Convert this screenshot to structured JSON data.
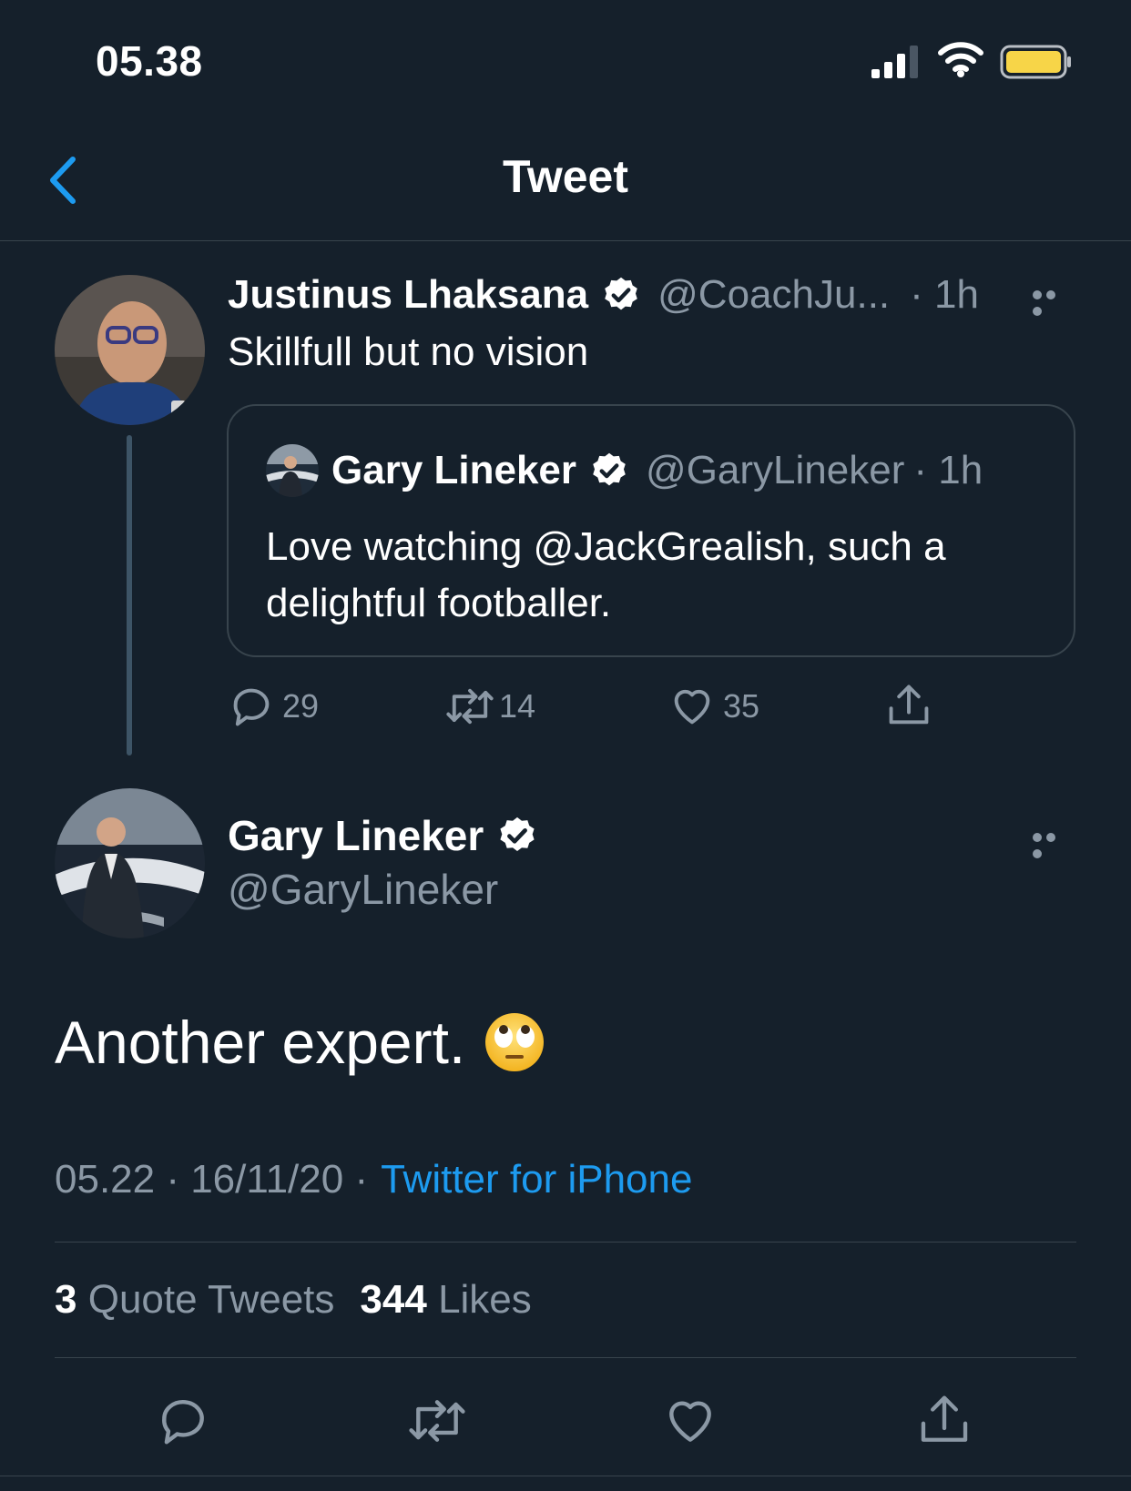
{
  "status_bar": {
    "time": "05.38"
  },
  "nav": {
    "title": "Tweet"
  },
  "reply_tweet": {
    "name": "Justinus Lhaksana",
    "handle": "@CoachJu...",
    "time": "· 1h",
    "text": "Skillfull but no vision",
    "quoted": {
      "name": "Gary Lineker",
      "handle": "@GaryLineker",
      "time": "· 1h",
      "text_line1": "Love watching @JackGrealish, such a",
      "text_line2": "delightful footballer."
    },
    "actions": {
      "replies": "29",
      "retweets": "14",
      "likes": "35"
    }
  },
  "main_tweet": {
    "name": "Gary Lineker",
    "handle": "@GaryLineker",
    "text": "Another expert.",
    "emoji": "face-with-rolling-eyes",
    "meta_time": "05.22 · 16/11/20 ·",
    "meta_source": "Twitter for iPhone",
    "stats": {
      "quote_count": "3",
      "quote_label": "Quote Tweets",
      "like_count": "344",
      "like_label": "Likes"
    }
  },
  "colors": {
    "background": "#15202b",
    "accent": "#1d9bf0",
    "muted": "#8b98a5",
    "divider": "#38444d",
    "battery": "#f7d548"
  }
}
